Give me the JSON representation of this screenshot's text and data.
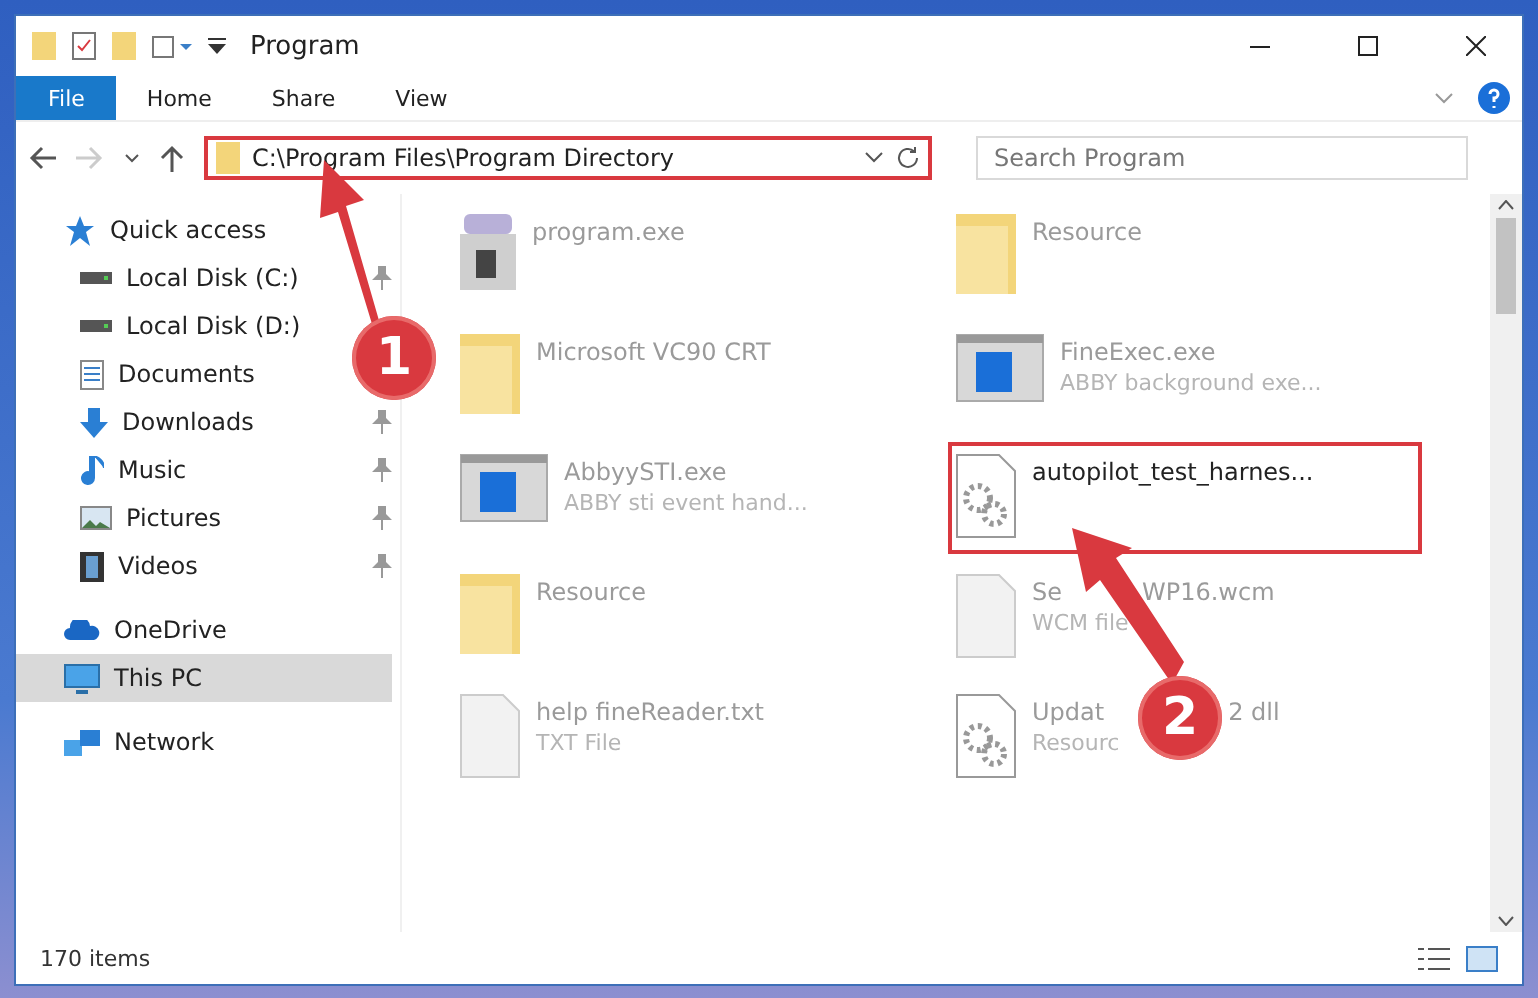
{
  "window": {
    "title": "Program"
  },
  "ribbon": {
    "tabs": [
      {
        "label": "File",
        "selected": true
      },
      {
        "label": "Home",
        "selected": false
      },
      {
        "label": "Share",
        "selected": false
      },
      {
        "label": "View",
        "selected": false
      }
    ]
  },
  "address_bar": {
    "path": "C:\\Program Files\\Program Directory"
  },
  "search": {
    "placeholder": "Search Program"
  },
  "sidebar": {
    "items": [
      {
        "label": "Quick access",
        "kind": "star",
        "pinned": false,
        "selected": false,
        "children": [
          {
            "label": "Local Disk (C:)",
            "kind": "drive",
            "pinned": true,
            "selected": false
          },
          {
            "label": "Local Disk (D:)",
            "kind": "drive",
            "pinned": false,
            "selected": false
          },
          {
            "label": "Documents",
            "kind": "document",
            "pinned": false,
            "selected": false
          },
          {
            "label": "Downloads",
            "kind": "download",
            "pinned": true,
            "selected": false
          },
          {
            "label": "Music",
            "kind": "music",
            "pinned": true,
            "selected": false
          },
          {
            "label": "Pictures",
            "kind": "pictures",
            "pinned": true,
            "selected": false
          },
          {
            "label": "Videos",
            "kind": "video",
            "pinned": true,
            "selected": false
          }
        ]
      },
      {
        "label": "OneDrive",
        "kind": "cloud",
        "pinned": false,
        "selected": false
      },
      {
        "label": "This PC",
        "kind": "monitor",
        "pinned": false,
        "selected": true
      },
      {
        "label": "Network",
        "kind": "network",
        "pinned": false,
        "selected": false
      }
    ]
  },
  "files": [
    {
      "name": "program.exe",
      "kind": "installer",
      "highlighted": false
    },
    {
      "name": "Resource",
      "kind": "folder",
      "highlighted": false
    },
    {
      "name": "Microsoft VC90 CRT",
      "kind": "folder",
      "highlighted": false
    },
    {
      "name": "FineExec.exe",
      "description": "ABBY background exe...",
      "kind": "app",
      "highlighted": false
    },
    {
      "name": "AbbyySTI.exe",
      "description": "ABBY sti event hand...",
      "kind": "app",
      "highlighted": false
    },
    {
      "name": "autopilot_test_harnes...",
      "kind": "gears",
      "highlighted": true
    },
    {
      "name": "Resource",
      "kind": "folder",
      "highlighted": false
    },
    {
      "name": "Se",
      "name_after_arrow": "WP16.wcm",
      "description": "WCM file",
      "kind": "blank",
      "highlighted": false
    },
    {
      "name": "help fineReader.txt",
      "description": "TXT File",
      "kind": "blank",
      "highlighted": false
    },
    {
      "name": "Updat",
      "name_after_arrow": "2 dll",
      "description": "Resourc",
      "kind": "gears",
      "highlighted": false
    }
  ],
  "status_bar": {
    "count": "170 items"
  },
  "annotations": [
    {
      "number": "1"
    },
    {
      "number": "2"
    }
  ]
}
